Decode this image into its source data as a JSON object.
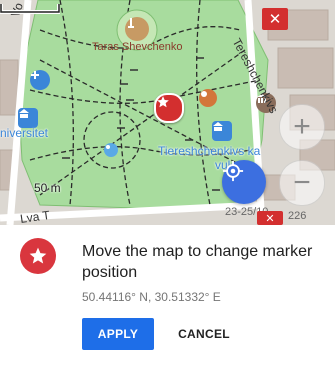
{
  "map": {
    "labels": {
      "park_name": "Taras Shevchenko",
      "poi_line1": "Tiereshchenkivs ka",
      "poi_line2": "vul",
      "university_fragment": "niversitet",
      "street_left": "Vo",
      "street_right": "Tereshchenkivs",
      "street_bottom": "Lva T",
      "address": "23-25/10",
      "address_2": "226"
    },
    "scale_text": "50 m",
    "icons": {
      "zoom_in": "plus-icon",
      "zoom_out": "minus-icon",
      "locate": "crosshair-icon",
      "close": "close-icon",
      "marker": "star-icon"
    },
    "colors": {
      "park": "#a8dc9e",
      "marker": "#d32f2f",
      "locate": "#3c6fe0"
    }
  },
  "panel": {
    "title": "Move the map to change marker position",
    "coordinates": "50.44116° N, 30.51332° E",
    "apply_label": "APPLY",
    "cancel_label": "CANCEL",
    "colors": {
      "apply": "#1e6ee8",
      "icon": "#d9363e"
    }
  }
}
